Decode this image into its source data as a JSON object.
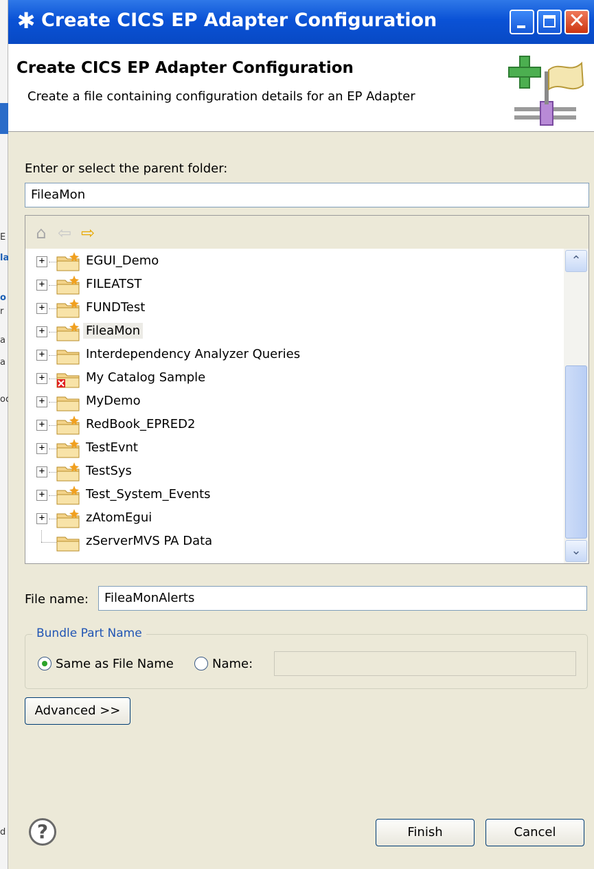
{
  "window": {
    "title": "Create CICS EP Adapter Configuration",
    "app_icon": "gear-star-icon"
  },
  "banner": {
    "heading": "Create CICS EP Adapter Configuration",
    "description": "Create a file containing configuration details for an EP Adapter",
    "graphic_icon": "new-adapter-wizard-icon"
  },
  "parent_folder": {
    "label": "Enter or select the parent folder:",
    "value": "FileaMon"
  },
  "tree": {
    "toolbar": [
      "home-icon",
      "back-arrow-icon",
      "forward-arrow-icon"
    ],
    "selected": "FileaMon",
    "items": [
      {
        "label": "EGUI_Demo",
        "type": "project-folder",
        "expandable": true
      },
      {
        "label": "FILEATST",
        "type": "project-folder",
        "expandable": true
      },
      {
        "label": "FUNDTest",
        "type": "project-folder",
        "expandable": true
      },
      {
        "label": "FileaMon",
        "type": "project-folder",
        "expandable": true
      },
      {
        "label": "Interdependency Analyzer Queries",
        "type": "folder",
        "expandable": true
      },
      {
        "label": "My Catalog Sample",
        "type": "error-folder",
        "expandable": true
      },
      {
        "label": "MyDemo",
        "type": "folder",
        "expandable": true
      },
      {
        "label": "RedBook_EPRED2",
        "type": "project-folder",
        "expandable": true
      },
      {
        "label": "TestEvnt",
        "type": "project-folder",
        "expandable": true
      },
      {
        "label": "TestSys",
        "type": "project-folder",
        "expandable": true
      },
      {
        "label": "Test_System_Events",
        "type": "project-folder",
        "expandable": true
      },
      {
        "label": "zAtomEgui",
        "type": "project-folder",
        "expandable": true
      },
      {
        "label": "zServerMVS PA Data",
        "type": "folder",
        "expandable": false
      }
    ]
  },
  "file_name": {
    "label": "File name:",
    "value": "FileaMonAlerts"
  },
  "bundle_part": {
    "title": "Bundle Part Name",
    "option_same": "Same as File Name",
    "option_name": "Name:",
    "selected": "Same as File Name",
    "name_value": ""
  },
  "buttons": {
    "advanced": "Advanced >>",
    "finish": "Finish",
    "cancel": "Cancel",
    "help": "?"
  },
  "background_window_fragments": [
    "E",
    "la",
    "o",
    "r",
    "a",
    "a",
    "oc",
    "d"
  ],
  "colors": {
    "titlebar": "#0a52d6",
    "dialog_bg": "#ece9d8",
    "group_title": "#2155b4",
    "radio_selected": "#2ba32b"
  }
}
